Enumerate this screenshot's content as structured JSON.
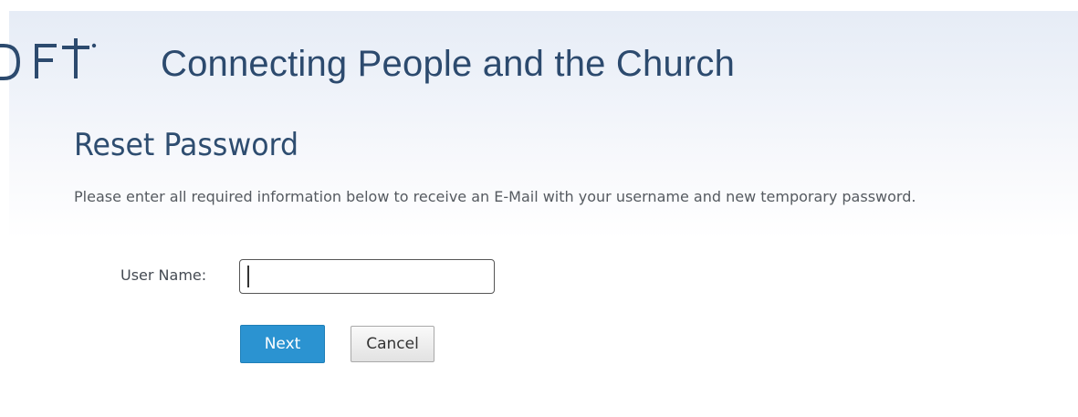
{
  "header": {
    "logo_text": "DFT",
    "tagline": "Connecting People and the Church"
  },
  "main": {
    "title": "Reset Password",
    "instructions": "Please enter all required information below to receive an E-Mail with your username and new temporary password.",
    "form": {
      "username_label": "User Name:",
      "username_value": "",
      "next_label": "Next",
      "cancel_label": "Cancel"
    }
  },
  "colors": {
    "brand_text": "#2c4a6e",
    "primary_button": "#2b93d1",
    "header_gradient_top": "#e6ecf6"
  }
}
